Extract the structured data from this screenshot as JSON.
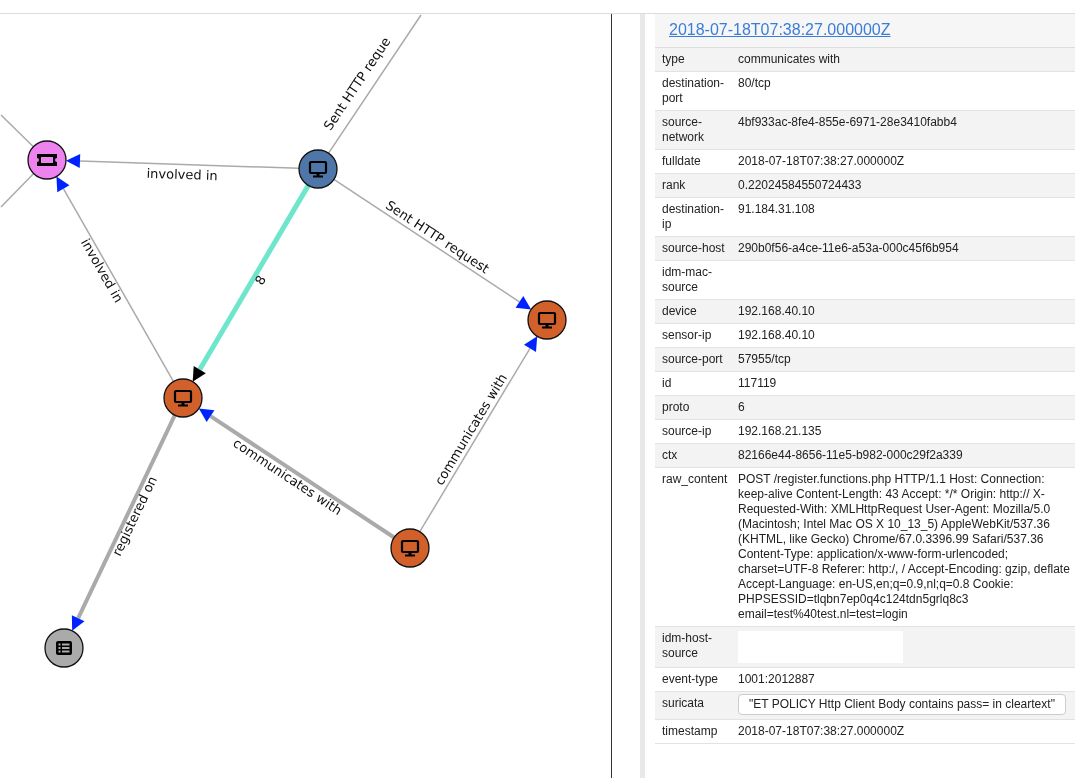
{
  "graph": {
    "nodes": [
      {
        "kind": "ticket",
        "color": "#ee82ee"
      },
      {
        "kind": "device",
        "color": "#4f76a8"
      },
      {
        "kind": "device",
        "color": "#d2602a"
      },
      {
        "kind": "device",
        "color": "#d2602a"
      },
      {
        "kind": "device",
        "color": "#d2602a"
      },
      {
        "kind": "list",
        "color": "#aaaaaa"
      }
    ],
    "edges": [
      {
        "label": "involved in",
        "kind": "normal"
      },
      {
        "label": "Sent HTTP reque",
        "kind": "normal"
      },
      {
        "label": "Sent HTTP request",
        "kind": "normal"
      },
      {
        "label": "8",
        "kind": "selected"
      },
      {
        "label": "involved in",
        "kind": "normal"
      },
      {
        "label": "communicates with",
        "kind": "heavy"
      },
      {
        "label": "communicates with",
        "kind": "normal"
      },
      {
        "label": "registered on",
        "kind": "heavy"
      },
      {
        "kind": "normal"
      },
      {
        "kind": "normal"
      }
    ]
  },
  "details": {
    "title": "2018-07-18T07:38:27.000000Z",
    "rows": [
      {
        "key": "type",
        "value": "communicates with",
        "kind": "text"
      },
      {
        "key": "destination-port",
        "value": "80/tcp",
        "kind": "text"
      },
      {
        "key": "source-network",
        "value": "4bf933ac-8fe4-855e-6971-28e3410fabb4",
        "kind": "text"
      },
      {
        "key": "fulldate",
        "value": "2018-07-18T07:38:27.000000Z",
        "kind": "text"
      },
      {
        "key": "rank",
        "value": "0.22024584550724433",
        "kind": "text"
      },
      {
        "key": "destination-ip",
        "value": "91.184.31.108",
        "kind": "text"
      },
      {
        "key": "source-host",
        "value": "290b0f56-a4ce-11e6-a53a-000c45f6b954",
        "kind": "text"
      },
      {
        "key": "idm-mac-source",
        "kind": "text"
      },
      {
        "key": "device",
        "value": "192.168.40.10",
        "kind": "text"
      },
      {
        "key": "sensor-ip",
        "value": "192.168.40.10",
        "kind": "text"
      },
      {
        "key": "source-port",
        "value": "57955/tcp",
        "kind": "text"
      },
      {
        "key": "id",
        "value": "117119",
        "kind": "text"
      },
      {
        "key": "proto",
        "value": "6",
        "kind": "text"
      },
      {
        "key": "source-ip",
        "value": "192.168.21.135",
        "kind": "text"
      },
      {
        "key": "ctx",
        "value": "82166e44-8656-11e5-b982-000c29f2a339",
        "kind": "text"
      },
      {
        "key": "raw_content",
        "value": "POST /register.functions.php HTTP/1.1 Host: Connection: keep-alive Content-Length: 43 Accept: */* Origin: http:// X-Requested-With: XMLHttpRequest User-Agent: Mozilla/5.0 (Macintosh; Intel Mac OS X 10_13_5) AppleWebKit/537.36 (KHTML, like Gecko) Chrome/67.0.3396.99 Safari/537.36 Content-Type: application/x-www-form-urlencoded; charset=UTF-8 Referer: http:/, / Accept-Encoding: gzip, deflate Accept-Language: en-US,en;q=0.9,nl;q=0.8 Cookie: PHPSESSID=tlqbn7ep0q4c124tdn5grlq8c3 email=test%40test.nl=test=login",
        "kind": "text"
      },
      {
        "key": "idm-host-source",
        "kind": "redacted"
      },
      {
        "key": "event-type",
        "value": "1001:2012887",
        "kind": "text"
      },
      {
        "key": "suricata",
        "value": "\"ET POLICY Http Client Body contains pass= in cleartext\"",
        "kind": "tag"
      },
      {
        "key": "timestamp",
        "value": "2018-07-18T07:38:27.000000Z",
        "kind": "text"
      }
    ]
  }
}
